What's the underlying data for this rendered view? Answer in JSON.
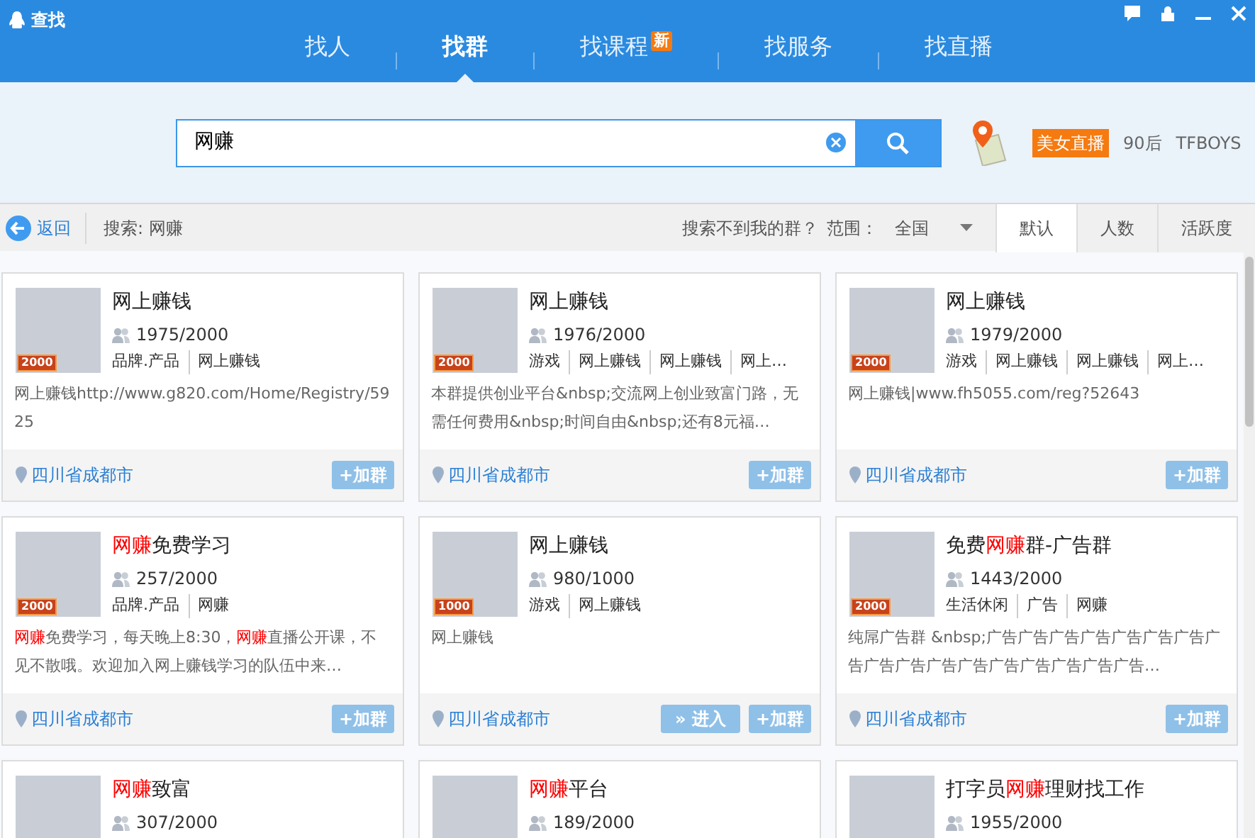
{
  "window": {
    "title": "查找"
  },
  "tabs": [
    {
      "label": "找人",
      "selected": false
    },
    {
      "label": "找群",
      "selected": true
    },
    {
      "label": "找课程",
      "selected": false,
      "badge": "新"
    },
    {
      "label": "找服务",
      "selected": false
    },
    {
      "label": "找直播",
      "selected": false
    }
  ],
  "search": {
    "value": "网赚"
  },
  "hot_words": [
    {
      "text": "美女直播",
      "kind": "tag"
    },
    {
      "text": "90后",
      "kind": "plain"
    },
    {
      "text": "TFBOYS",
      "kind": "plain"
    }
  ],
  "filter_bar": {
    "back": "返回",
    "query": "搜索: 网赚",
    "help_link": "搜索不到我的群？",
    "range_label": "范围：",
    "range_value": "全国",
    "sort_tabs": [
      {
        "label": "默认",
        "selected": true
      },
      {
        "label": "人数",
        "selected": false
      },
      {
        "label": "活跃度",
        "selected": false
      }
    ]
  },
  "groups": [
    {
      "title": [
        {
          "text": "网上赚钱",
          "highlight": false
        }
      ],
      "level_badge": "2000",
      "members": "1975/2000",
      "tags": [
        "品牌.产品",
        "网上赚钱"
      ],
      "description": [
        {
          "text": "网上赚钱http://www.g820.com/Home/Registry/5925",
          "highlight": false
        }
      ],
      "location": "四川省成都市",
      "buttons": [
        {
          "label": "+加群",
          "kind": "join"
        }
      ]
    },
    {
      "title": [
        {
          "text": "网上赚钱",
          "highlight": false
        }
      ],
      "level_badge": "2000",
      "members": "1976/2000",
      "tags": [
        "游戏",
        "网上赚钱",
        "网上赚钱",
        "网上…"
      ],
      "description": [
        {
          "text": "本群提供创业平台&nbsp;交流网上创业致富门路，无需任何费用&nbsp;时间自由&nbsp;还有8元福…",
          "highlight": false
        }
      ],
      "location": "四川省成都市",
      "buttons": [
        {
          "label": "+加群",
          "kind": "join"
        }
      ]
    },
    {
      "title": [
        {
          "text": "网上赚钱",
          "highlight": false
        }
      ],
      "level_badge": "2000",
      "members": "1979/2000",
      "tags": [
        "游戏",
        "网上赚钱",
        "网上赚钱",
        "网上…"
      ],
      "description": [
        {
          "text": "网上赚钱|www.fh5055.com/reg?52643",
          "highlight": false
        }
      ],
      "location": "四川省成都市",
      "buttons": [
        {
          "label": "+加群",
          "kind": "join"
        }
      ]
    },
    {
      "title": [
        {
          "text": "网赚",
          "highlight": true
        },
        {
          "text": "免费学习",
          "highlight": false
        }
      ],
      "level_badge": "2000",
      "members": "257/2000",
      "tags": [
        "品牌.产品",
        "网赚"
      ],
      "description": [
        {
          "text": "网赚",
          "highlight": true
        },
        {
          "text": "免费学习，每天晚上8:30，",
          "highlight": false
        },
        {
          "text": "网赚",
          "highlight": true
        },
        {
          "text": "直播公开课，不见不散哦。欢迎加入网上赚钱学习的队伍中来…",
          "highlight": false
        }
      ],
      "location": "四川省成都市",
      "buttons": [
        {
          "label": "+加群",
          "kind": "join"
        }
      ]
    },
    {
      "title": [
        {
          "text": "网上赚钱",
          "highlight": false
        }
      ],
      "level_badge": "1000",
      "members": "980/1000",
      "tags": [
        "游戏",
        "网上赚钱"
      ],
      "description": [
        {
          "text": "网上赚钱",
          "highlight": false
        }
      ],
      "location": "四川省成都市",
      "buttons": [
        {
          "label": "» 进入",
          "kind": "enter"
        },
        {
          "label": "+加群",
          "kind": "join"
        }
      ]
    },
    {
      "title": [
        {
          "text": "免费",
          "highlight": false
        },
        {
          "text": "网赚",
          "highlight": true
        },
        {
          "text": "群-广告群",
          "highlight": false
        }
      ],
      "level_badge": "2000",
      "members": "1443/2000",
      "tags": [
        "生活休闲",
        "广告",
        "网赚"
      ],
      "description": [
        {
          "text": "纯屌广告群 &nbsp;广告广告广告广告广告广告广告广告广告广告广告广告广告广告广告广告广告…",
          "highlight": false
        }
      ],
      "location": "四川省成都市",
      "buttons": [
        {
          "label": "+加群",
          "kind": "join"
        }
      ]
    },
    {
      "title": [
        {
          "text": "网赚",
          "highlight": true
        },
        {
          "text": "致富",
          "highlight": false
        }
      ],
      "members": "307/2000"
    },
    {
      "title": [
        {
          "text": "网赚",
          "highlight": true
        },
        {
          "text": "平台",
          "highlight": false
        }
      ],
      "members": "189/2000"
    },
    {
      "title": [
        {
          "text": "打字员",
          "highlight": false
        },
        {
          "text": "网赚",
          "highlight": true
        },
        {
          "text": "理财找工作",
          "highlight": false
        }
      ],
      "members": "1955/2000"
    }
  ]
}
